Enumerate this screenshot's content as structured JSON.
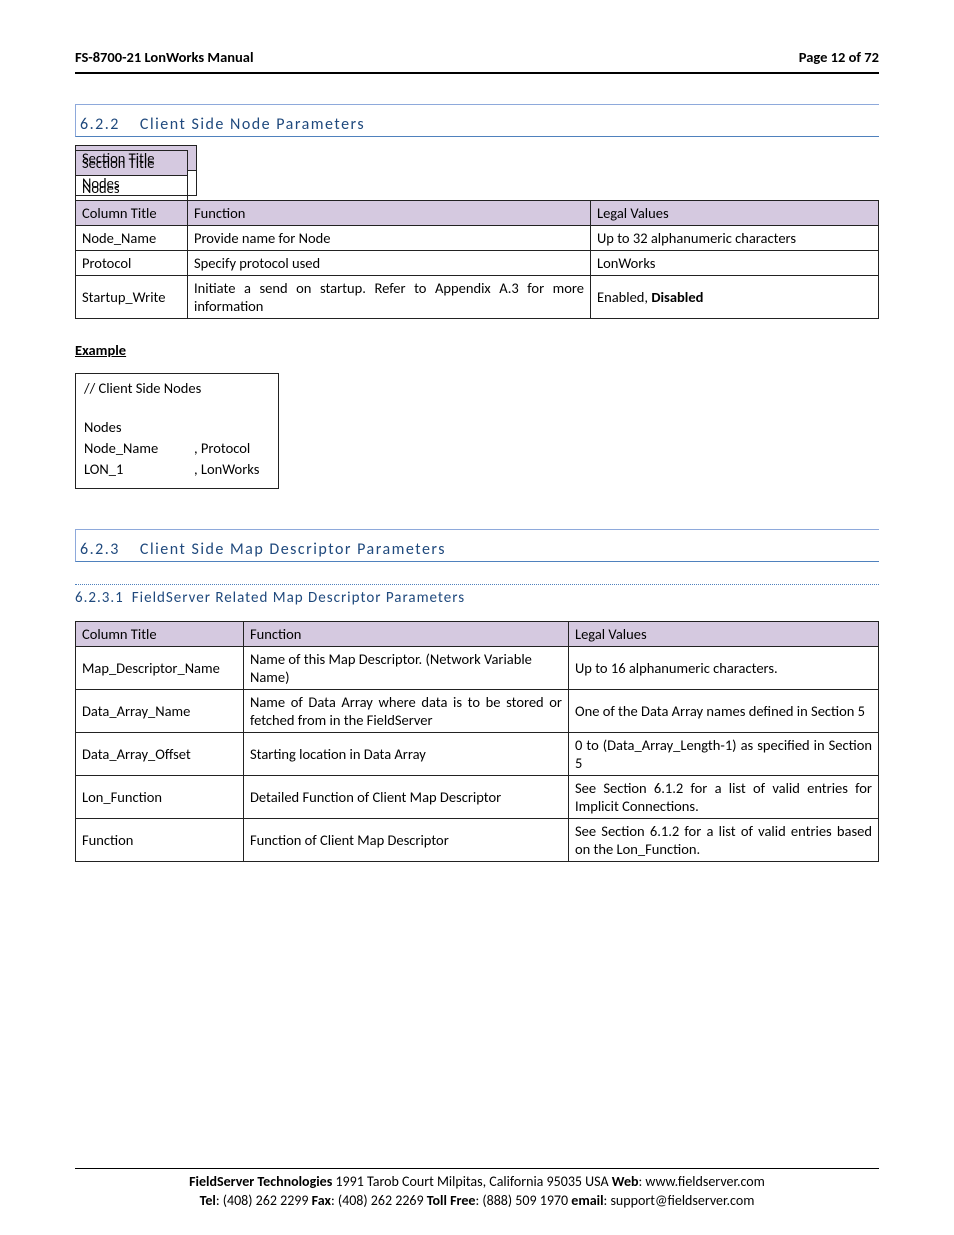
{
  "header": {
    "title": "FS-8700-21 LonWorks Manual",
    "page": "Page 12 of 72"
  },
  "s622": {
    "num": "6.2.2",
    "title": "Client Side Node Parameters",
    "section_title_label": "Section Title",
    "nodes_label": "Nodes",
    "column_title_label": "Column Title",
    "function_label": "Function",
    "legal_values_label": "Legal Values",
    "rows": [
      {
        "ct": "Node_Name",
        "fn": "Provide name for Node",
        "lv": "Up to 32 alphanumeric characters"
      },
      {
        "ct": "Protocol",
        "fn": "Specify protocol used",
        "lv": "LonWorks"
      },
      {
        "ct": "Startup_Write",
        "fn": "Initiate a send on startup.  Refer to Appendix A.3 for more information",
        "lv_a": "Enabled, ",
        "lv_b": "Disabled"
      }
    ]
  },
  "example": {
    "title": "Example",
    "comment": "//    Client Side Nodes",
    "nodes": "Nodes",
    "hdr1": "Node_Name",
    "hdr2": ", Protocol",
    "val1": "LON_1",
    "val2": ", LonWorks"
  },
  "s623": {
    "num": "6.2.3",
    "title": "Client Side Map Descriptor Parameters"
  },
  "s6231": {
    "num": "6.2.3.1",
    "title": "FieldServer Related Map Descriptor Parameters",
    "column_title_label": "Column Title",
    "function_label": "Function",
    "legal_values_label": "Legal Values",
    "rows": [
      {
        "ct": "Map_Descriptor_Name",
        "fn": "Name of this Map Descriptor. (Network Variable Name)",
        "lv": "Up to 16 alphanumeric characters."
      },
      {
        "ct": "Data_Array_Name",
        "fn": "Name of Data Array where data is to be stored or fetched from in the FieldServer",
        "lv": "One of the Data Array names defined in Section 5"
      },
      {
        "ct": "Data_Array_Offset",
        "fn": "Starting location in Data Array",
        "lv": "0 to (Data_Array_Length-1) as specified in Section 5"
      },
      {
        "ct": "Lon_Function",
        "fn": "Detailed Function of Client Map Descriptor",
        "lv": "See Section 6.1.2 for a list of valid entries for Implicit Connections."
      },
      {
        "ct": "Function",
        "fn": "Function of Client Map Descriptor",
        "lv": "See Section 6.1.2 for a list of valid entries based on the Lon_Function."
      }
    ]
  },
  "footer": {
    "company": "FieldServer Technologies",
    "address": " 1991 Tarob Court Milpitas, California 95035 USA   ",
    "web_label": "Web",
    "web": ": www.fieldserver.com",
    "tel_label": "Tel",
    "tel": ": (408) 262 2299   ",
    "fax_label": "Fax",
    "fax": ": (408) 262 2269   ",
    "tollfree_label": "Toll Free",
    "tollfree": ": (888) 509 1970   ",
    "email_label": "email",
    "email": ": support@fieldserver.com"
  }
}
